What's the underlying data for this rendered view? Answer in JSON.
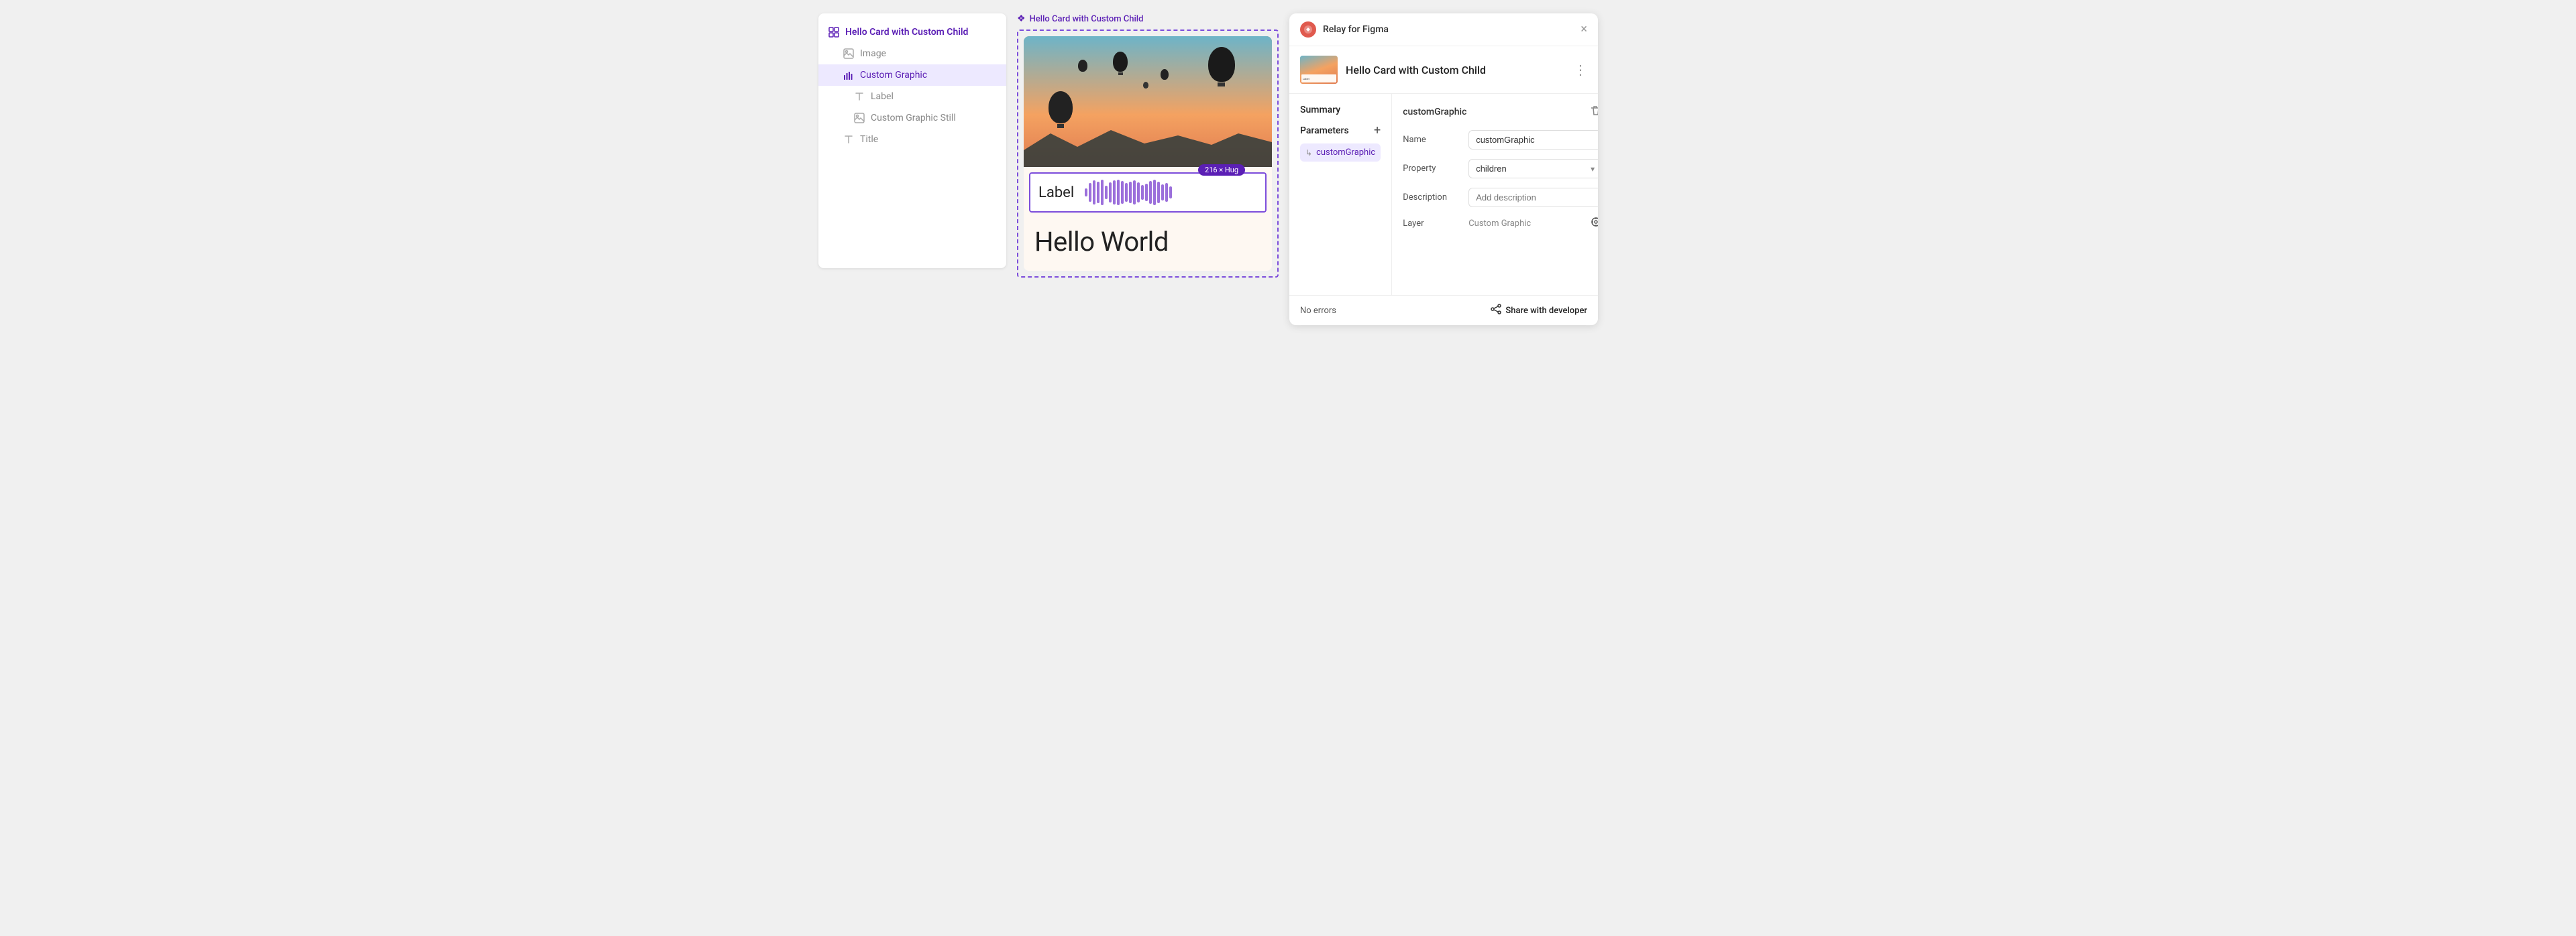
{
  "left_panel": {
    "title": "Hello Card with Custom Child",
    "items": [
      {
        "id": "root",
        "label": "Hello Card with Custom Child",
        "level": 0,
        "icon": "grid-icon",
        "selected": false
      },
      {
        "id": "image",
        "label": "Image",
        "level": 1,
        "icon": "image-icon",
        "selected": false
      },
      {
        "id": "custom-graphic",
        "label": "Custom Graphic",
        "level": 1,
        "icon": "bar-chart-icon",
        "selected": true
      },
      {
        "id": "label",
        "label": "Label",
        "level": 2,
        "icon": "text-icon",
        "selected": false
      },
      {
        "id": "custom-graphic-still",
        "label": "Custom Graphic Still",
        "level": 2,
        "icon": "image-icon",
        "selected": false
      },
      {
        "id": "title",
        "label": "Title",
        "level": 1,
        "icon": "text-icon",
        "selected": false
      }
    ]
  },
  "canvas": {
    "title": "Hello Card with Custom Child",
    "size_badge": "216 × Hug",
    "label_text": "Label",
    "hello_world": "Hello World"
  },
  "right_panel": {
    "app_name": "Relay for Figma",
    "close_label": "×",
    "card_title": "Hello Card with Custom Child",
    "more_icon": "⋮",
    "thumbnail_label": "Hello World",
    "summary_title": "Summary",
    "parameters_title": "Parameters",
    "param_item": "customGraphic",
    "property_title": "customGraphic",
    "fields": {
      "name_label": "Name",
      "name_value": "customGraphic",
      "property_label": "Property",
      "property_value": "children",
      "description_label": "Description",
      "description_placeholder": "Add description",
      "layer_label": "Layer",
      "layer_value": "Custom Graphic"
    },
    "footer": {
      "no_errors": "No errors",
      "share_button": "Share with developer"
    }
  }
}
